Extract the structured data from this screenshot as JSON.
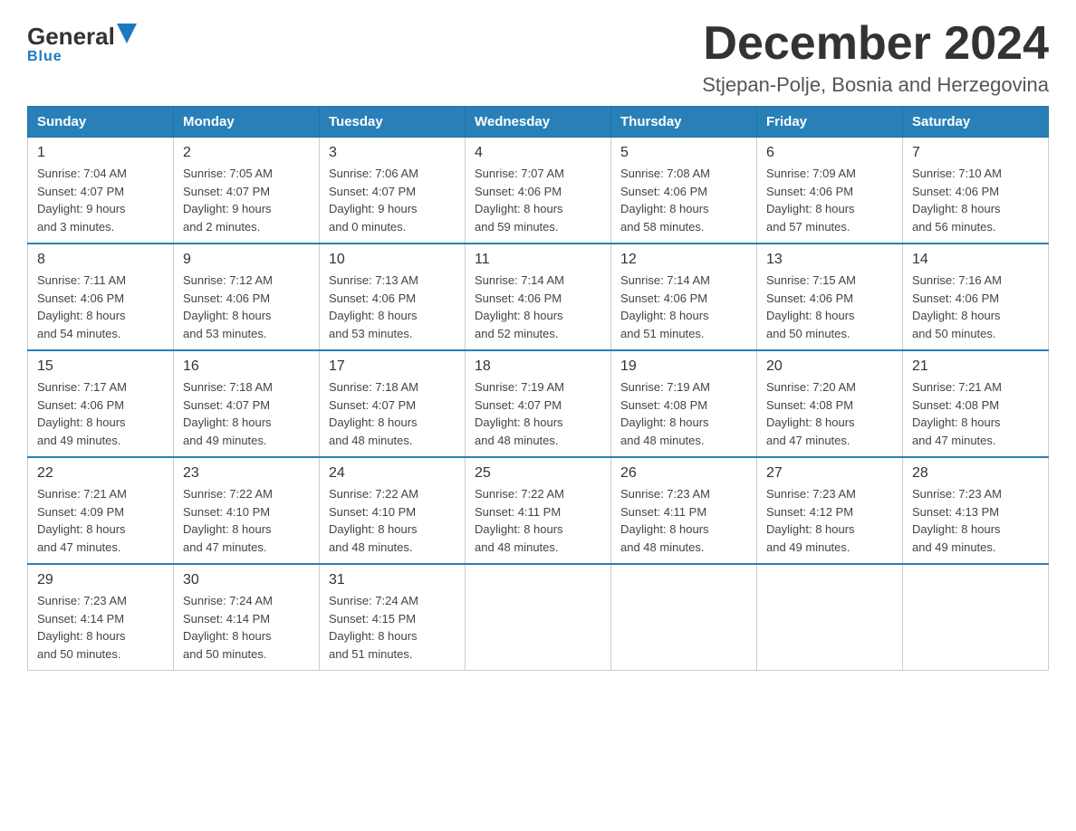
{
  "header": {
    "logo_general": "General",
    "logo_blue": "Blue",
    "month_title": "December 2024",
    "location": "Stjepan-Polje, Bosnia and Herzegovina"
  },
  "days_of_week": [
    "Sunday",
    "Monday",
    "Tuesday",
    "Wednesday",
    "Thursday",
    "Friday",
    "Saturday"
  ],
  "weeks": [
    [
      {
        "day": "1",
        "sunrise": "7:04 AM",
        "sunset": "4:07 PM",
        "daylight": "9 hours and 3 minutes."
      },
      {
        "day": "2",
        "sunrise": "7:05 AM",
        "sunset": "4:07 PM",
        "daylight": "9 hours and 2 minutes."
      },
      {
        "day": "3",
        "sunrise": "7:06 AM",
        "sunset": "4:07 PM",
        "daylight": "9 hours and 0 minutes."
      },
      {
        "day": "4",
        "sunrise": "7:07 AM",
        "sunset": "4:06 PM",
        "daylight": "8 hours and 59 minutes."
      },
      {
        "day": "5",
        "sunrise": "7:08 AM",
        "sunset": "4:06 PM",
        "daylight": "8 hours and 58 minutes."
      },
      {
        "day": "6",
        "sunrise": "7:09 AM",
        "sunset": "4:06 PM",
        "daylight": "8 hours and 57 minutes."
      },
      {
        "day": "7",
        "sunrise": "7:10 AM",
        "sunset": "4:06 PM",
        "daylight": "8 hours and 56 minutes."
      }
    ],
    [
      {
        "day": "8",
        "sunrise": "7:11 AM",
        "sunset": "4:06 PM",
        "daylight": "8 hours and 54 minutes."
      },
      {
        "day": "9",
        "sunrise": "7:12 AM",
        "sunset": "4:06 PM",
        "daylight": "8 hours and 53 minutes."
      },
      {
        "day": "10",
        "sunrise": "7:13 AM",
        "sunset": "4:06 PM",
        "daylight": "8 hours and 53 minutes."
      },
      {
        "day": "11",
        "sunrise": "7:14 AM",
        "sunset": "4:06 PM",
        "daylight": "8 hours and 52 minutes."
      },
      {
        "day": "12",
        "sunrise": "7:14 AM",
        "sunset": "4:06 PM",
        "daylight": "8 hours and 51 minutes."
      },
      {
        "day": "13",
        "sunrise": "7:15 AM",
        "sunset": "4:06 PM",
        "daylight": "8 hours and 50 minutes."
      },
      {
        "day": "14",
        "sunrise": "7:16 AM",
        "sunset": "4:06 PM",
        "daylight": "8 hours and 50 minutes."
      }
    ],
    [
      {
        "day": "15",
        "sunrise": "7:17 AM",
        "sunset": "4:06 PM",
        "daylight": "8 hours and 49 minutes."
      },
      {
        "day": "16",
        "sunrise": "7:18 AM",
        "sunset": "4:07 PM",
        "daylight": "8 hours and 49 minutes."
      },
      {
        "day": "17",
        "sunrise": "7:18 AM",
        "sunset": "4:07 PM",
        "daylight": "8 hours and 48 minutes."
      },
      {
        "day": "18",
        "sunrise": "7:19 AM",
        "sunset": "4:07 PM",
        "daylight": "8 hours and 48 minutes."
      },
      {
        "day": "19",
        "sunrise": "7:19 AM",
        "sunset": "4:08 PM",
        "daylight": "8 hours and 48 minutes."
      },
      {
        "day": "20",
        "sunrise": "7:20 AM",
        "sunset": "4:08 PM",
        "daylight": "8 hours and 47 minutes."
      },
      {
        "day": "21",
        "sunrise": "7:21 AM",
        "sunset": "4:08 PM",
        "daylight": "8 hours and 47 minutes."
      }
    ],
    [
      {
        "day": "22",
        "sunrise": "7:21 AM",
        "sunset": "4:09 PM",
        "daylight": "8 hours and 47 minutes."
      },
      {
        "day": "23",
        "sunrise": "7:22 AM",
        "sunset": "4:10 PM",
        "daylight": "8 hours and 47 minutes."
      },
      {
        "day": "24",
        "sunrise": "7:22 AM",
        "sunset": "4:10 PM",
        "daylight": "8 hours and 48 minutes."
      },
      {
        "day": "25",
        "sunrise": "7:22 AM",
        "sunset": "4:11 PM",
        "daylight": "8 hours and 48 minutes."
      },
      {
        "day": "26",
        "sunrise": "7:23 AM",
        "sunset": "4:11 PM",
        "daylight": "8 hours and 48 minutes."
      },
      {
        "day": "27",
        "sunrise": "7:23 AM",
        "sunset": "4:12 PM",
        "daylight": "8 hours and 49 minutes."
      },
      {
        "day": "28",
        "sunrise": "7:23 AM",
        "sunset": "4:13 PM",
        "daylight": "8 hours and 49 minutes."
      }
    ],
    [
      {
        "day": "29",
        "sunrise": "7:23 AM",
        "sunset": "4:14 PM",
        "daylight": "8 hours and 50 minutes."
      },
      {
        "day": "30",
        "sunrise": "7:24 AM",
        "sunset": "4:14 PM",
        "daylight": "8 hours and 50 minutes."
      },
      {
        "day": "31",
        "sunrise": "7:24 AM",
        "sunset": "4:15 PM",
        "daylight": "8 hours and 51 minutes."
      },
      null,
      null,
      null,
      null
    ]
  ],
  "labels": {
    "sunrise": "Sunrise:",
    "sunset": "Sunset:",
    "daylight": "Daylight:"
  }
}
